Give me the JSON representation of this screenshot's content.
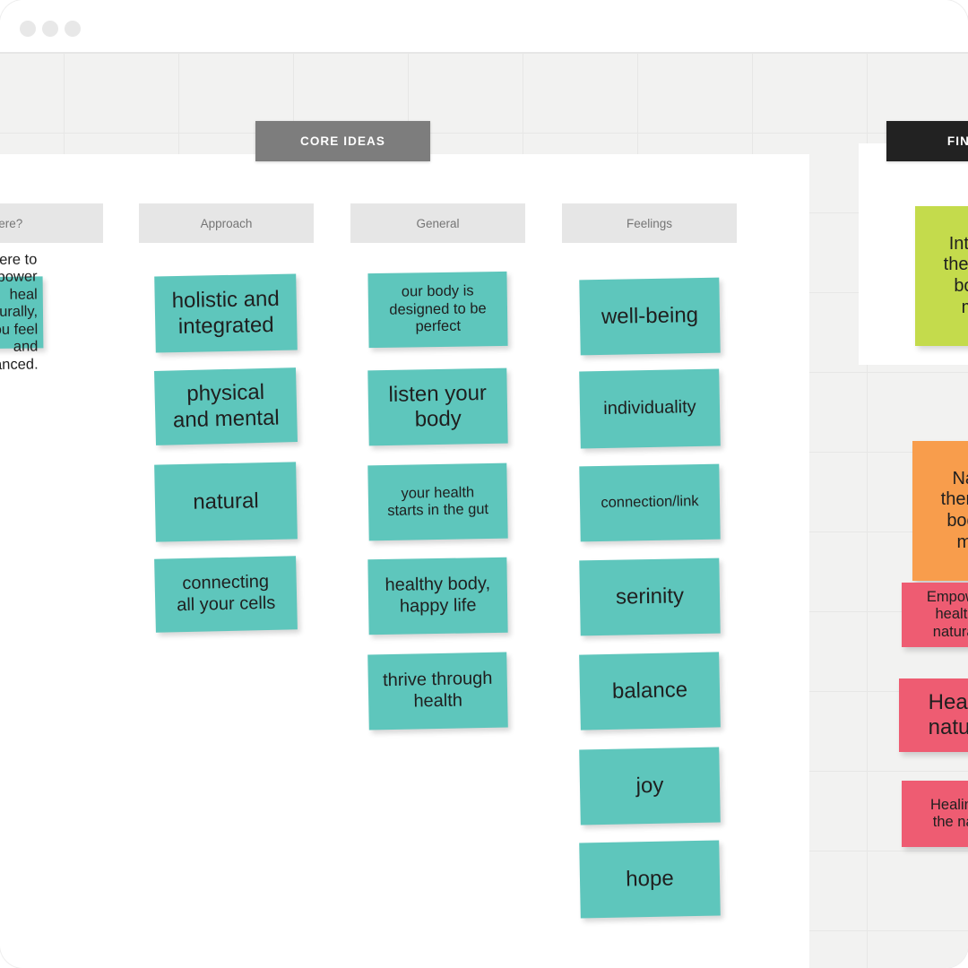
{
  "window": {
    "traffic_lights": [
      "close-dot",
      "minimize-dot",
      "maximize-dot"
    ]
  },
  "boards": [
    {
      "id": "core",
      "tab_label": "CORE IDEAS",
      "tab_color": "#7d7d7d"
    },
    {
      "id": "final",
      "tab_label": "FINAL T",
      "tab_color": "#222222"
    }
  ],
  "columns": [
    {
      "id": "why",
      "label": "re we here?"
    },
    {
      "id": "approach",
      "label": "Approach"
    },
    {
      "id": "general",
      "label": "General"
    },
    {
      "id": "feelings",
      "label": "Feelings"
    }
  ],
  "notes": {
    "why": [
      {
        "text": "ere to empower\nheal naturally,\nhelp you feel\nand balanced.",
        "color": "#5ec6bc",
        "size": "sm"
      }
    ],
    "approach": [
      {
        "text": "holistic and\nintegrated",
        "color": "#5ec6bc",
        "size": "lg"
      },
      {
        "text": "physical\nand mental",
        "color": "#5ec6bc",
        "size": "lg"
      },
      {
        "text": "natural",
        "color": "#5ec6bc",
        "size": "lg"
      },
      {
        "text": "connecting\nall your cells",
        "color": "#5ec6bc",
        "size": "md"
      }
    ],
    "general": [
      {
        "text": "our body is\ndesigned to be\nperfect",
        "color": "#5ec6bc",
        "size": "sm"
      },
      {
        "text": "listen your\nbody",
        "color": "#5ec6bc",
        "size": "lg"
      },
      {
        "text": "your health\nstarts in the gut",
        "color": "#5ec6bc",
        "size": "sm"
      },
      {
        "text": "healthy body,\nhappy life",
        "color": "#5ec6bc",
        "size": "md"
      },
      {
        "text": "thrive through\nhealth",
        "color": "#5ec6bc",
        "size": "md"
      }
    ],
    "feelings": [
      {
        "text": "well-being",
        "color": "#5ec6bc",
        "size": "lg"
      },
      {
        "text": "individuality",
        "color": "#5ec6bc",
        "size": "md"
      },
      {
        "text": "connection/link",
        "color": "#5ec6bc",
        "size": "sm"
      },
      {
        "text": "serinity",
        "color": "#5ec6bc",
        "size": "lg"
      },
      {
        "text": "balance",
        "color": "#5ec6bc",
        "size": "lg"
      },
      {
        "text": "joy",
        "color": "#5ec6bc",
        "size": "lg"
      },
      {
        "text": "hope",
        "color": "#5ec6bc",
        "size": "lg"
      }
    ],
    "final": [
      {
        "text": "Integ\ntherap\nbod\nm",
        "color": "#c4db4c",
        "size": "md"
      },
      {
        "text": "Nat\ntherap\nbody\nmi",
        "color": "#f89d4c",
        "size": "md"
      },
      {
        "text": "Empowe\nhealth\nnatural",
        "color": "#ee5c72",
        "size": "sm"
      },
      {
        "text": "Heali\nnatur",
        "color": "#ee5c72",
        "size": "lg"
      },
      {
        "text": "Healing\nthe nat",
        "color": "#ee5c72",
        "size": "sm"
      }
    ]
  },
  "palette": {
    "teal": "#5ec6bc",
    "green": "#c4db4c",
    "orange": "#f89d4c",
    "pink": "#ee5c72",
    "canvas_bg": "#f2f2f1",
    "grid_line": "#e7e7e6",
    "header_bg": "#e6e6e6",
    "header_text": "#757575",
    "board_white": "#ffffff"
  }
}
